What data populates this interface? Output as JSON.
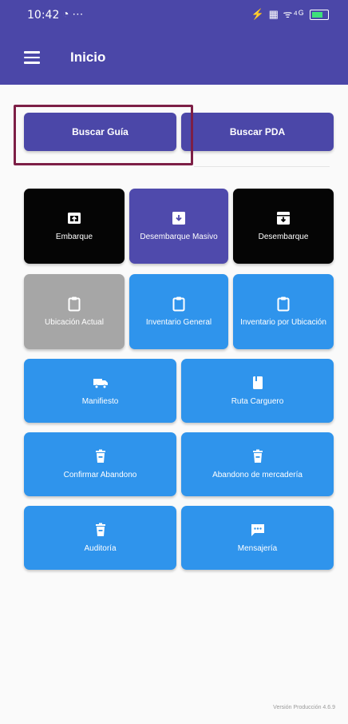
{
  "status_bar": {
    "time": "10:42",
    "left_icons": "◔ ⋯",
    "right_icons": "⚡ ▦ ᯤ⁴ᴳ"
  },
  "app_bar": {
    "title": "Inicio"
  },
  "actions": [
    {
      "label": "Buscar Guía",
      "icon": "search"
    },
    {
      "label": "Buscar PDA",
      "icon": "search"
    }
  ],
  "tiles": [
    {
      "label": "Embarque",
      "icon": "unarchive-icon",
      "color": "black"
    },
    {
      "label": "Desembarque Masivo",
      "icon": "archive-icon",
      "color": "purple"
    },
    {
      "label": "Desembarque",
      "icon": "archive-icon",
      "color": "black"
    },
    {
      "label": "Ubicación Actual",
      "icon": "clipboard-icon",
      "color": "gray"
    },
    {
      "label": "Inventario General",
      "icon": "clipboard-icon",
      "color": "blue"
    },
    {
      "label": "Inventario por Ubicación",
      "icon": "clipboard-icon",
      "color": "blue"
    },
    {
      "label": "Manifiesto",
      "icon": "truck-icon",
      "color": "blue"
    },
    {
      "label": "Ruta Carguero",
      "icon": "book-icon",
      "color": "blue"
    },
    {
      "label": "Confirmar Abandono",
      "icon": "trash-icon",
      "color": "blue"
    },
    {
      "label": "Abandono de mercadería",
      "icon": "trash-icon",
      "color": "blue"
    },
    {
      "label": "Auditoría",
      "icon": "trash-icon",
      "color": "blue"
    },
    {
      "label": "Mensajería",
      "icon": "chat-icon",
      "color": "blue"
    }
  ],
  "colors": {
    "primary": "#4b47a8",
    "tile_blue": "#2f94ec",
    "tile_black": "#050505",
    "tile_gray": "#a6a6a6",
    "highlight": "#7d1f46"
  },
  "footer": {
    "version": "Versión Producción 4.6.9"
  }
}
